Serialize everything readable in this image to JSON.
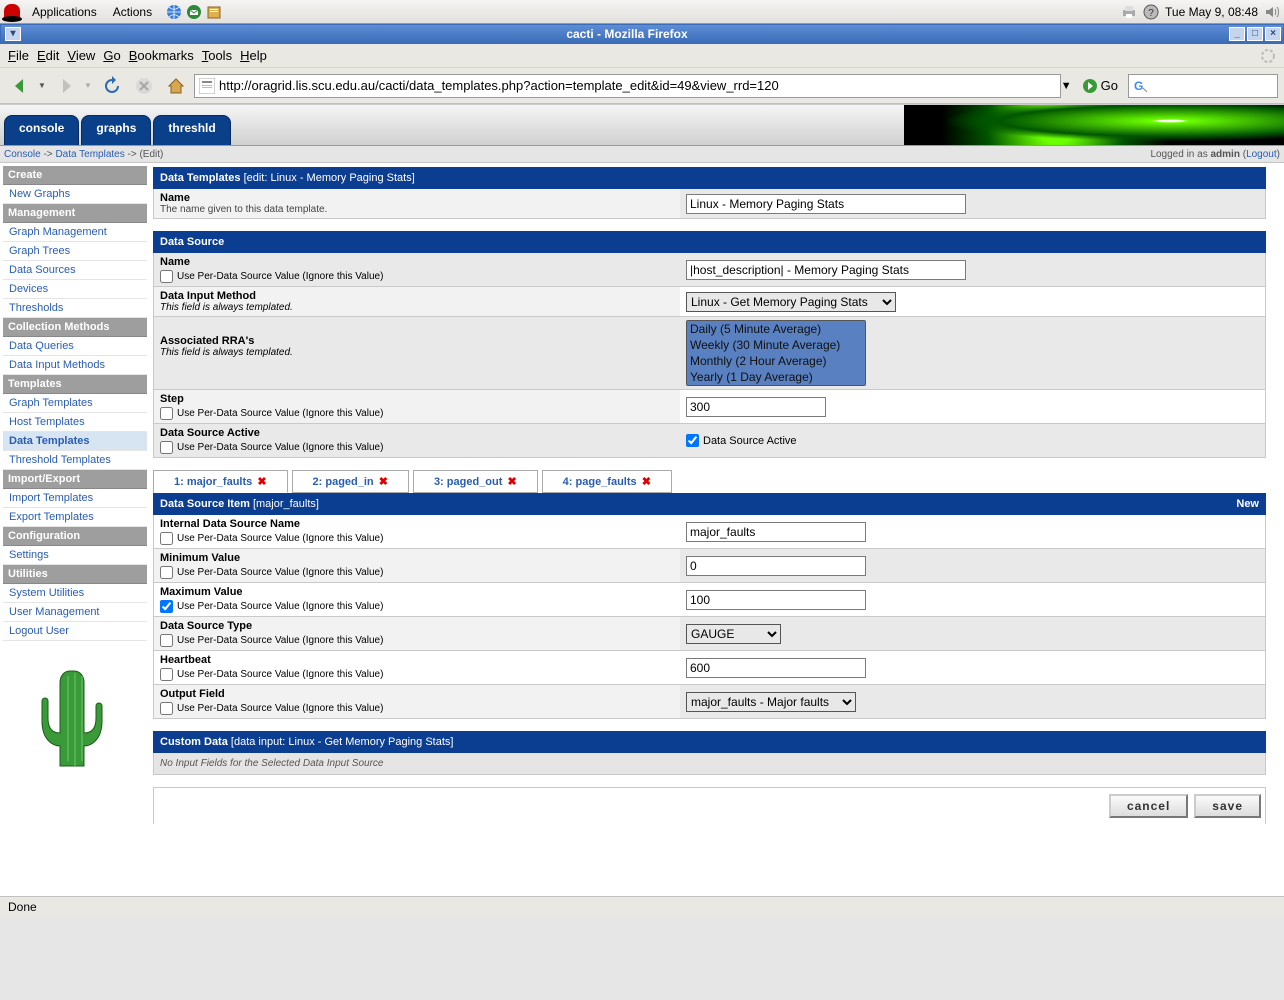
{
  "gnome": {
    "applications": "Applications",
    "actions": "Actions",
    "clock": "Tue May  9, 08:48"
  },
  "firefox": {
    "title": "cacti - Mozilla Firefox",
    "menubar": [
      "File",
      "Edit",
      "View",
      "Go",
      "Bookmarks",
      "Tools",
      "Help"
    ],
    "url": "http://oragrid.lis.scu.edu.au/cacti/data_templates.php?action=template_edit&id=49&view_rrd=120",
    "go_label": "Go",
    "status": "Done"
  },
  "cacti": {
    "tabs": [
      "console",
      "graphs",
      "threshld"
    ],
    "breadcrumb": {
      "root": "Console",
      "section": "Data Templates",
      "current": "(Edit)"
    },
    "login": {
      "prefix": "Logged in as ",
      "user": "admin",
      "logout": "Logout"
    },
    "sidebar": {
      "groups": [
        {
          "header": "Create",
          "items": [
            {
              "label": "New Graphs"
            }
          ]
        },
        {
          "header": "Management",
          "items": [
            {
              "label": "Graph Management"
            },
            {
              "label": "Graph Trees"
            },
            {
              "label": "Data Sources"
            },
            {
              "label": "Devices"
            },
            {
              "label": "Thresholds"
            }
          ]
        },
        {
          "header": "Collection Methods",
          "items": [
            {
              "label": "Data Queries"
            },
            {
              "label": "Data Input Methods"
            }
          ]
        },
        {
          "header": "Templates",
          "items": [
            {
              "label": "Graph Templates"
            },
            {
              "label": "Host Templates"
            },
            {
              "label": "Data Templates",
              "active": true
            },
            {
              "label": "Threshold Templates"
            }
          ]
        },
        {
          "header": "Import/Export",
          "items": [
            {
              "label": "Import Templates"
            },
            {
              "label": "Export Templates"
            }
          ]
        },
        {
          "header": "Configuration",
          "items": [
            {
              "label": "Settings"
            }
          ]
        },
        {
          "header": "Utilities",
          "items": [
            {
              "label": "System Utilities"
            },
            {
              "label": "User Management"
            },
            {
              "label": "Logout User"
            }
          ]
        }
      ]
    },
    "panels": {
      "data_templates": {
        "title": "Data Templates",
        "sub": "[edit: Linux - Memory Paging Stats]",
        "name_label": "Name",
        "name_desc": "The name given to this data template.",
        "name_value": "Linux - Memory Paging Stats"
      },
      "data_source": {
        "title": "Data Source",
        "per_data": "Use Per-Data Source Value (Ignore this Value)",
        "name_label": "Name",
        "name_value": "|host_description| - Memory Paging Stats",
        "dim_label": "Data Input Method",
        "templated": "This field is always templated.",
        "dim_value": "Linux - Get Memory Paging Stats",
        "rra_label": "Associated RRA's",
        "rra_options": [
          "Daily (5 Minute Average)",
          "Weekly (30 Minute Average)",
          "Monthly (2 Hour Average)",
          "Yearly (1 Day Average)"
        ],
        "step_label": "Step",
        "step_value": "300",
        "active_label": "Data Source Active",
        "active_cb": "Data Source Active"
      },
      "ds_items": {
        "tabs": [
          {
            "n": "1",
            "name": "major_faults"
          },
          {
            "n": "2",
            "name": "paged_in"
          },
          {
            "n": "3",
            "name": "paged_out"
          },
          {
            "n": "4",
            "name": "page_faults"
          }
        ],
        "title": "Data Source Item",
        "sub": "[major_faults]",
        "new": "New",
        "idsn_label": "Internal Data Source Name",
        "idsn_value": "major_faults",
        "min_label": "Minimum Value",
        "min_value": "0",
        "max_label": "Maximum Value",
        "max_value": "100",
        "dst_label": "Data Source Type",
        "dst_value": "GAUGE",
        "hb_label": "Heartbeat",
        "hb_value": "600",
        "of_label": "Output Field",
        "of_value": "major_faults - Major faults"
      },
      "custom": {
        "title": "Custom Data",
        "sub": "[data input: Linux - Get Memory Paging Stats]",
        "note": "No Input Fields for the Selected Data Input Source"
      }
    },
    "buttons": {
      "cancel": "cancel",
      "save": "save"
    }
  }
}
